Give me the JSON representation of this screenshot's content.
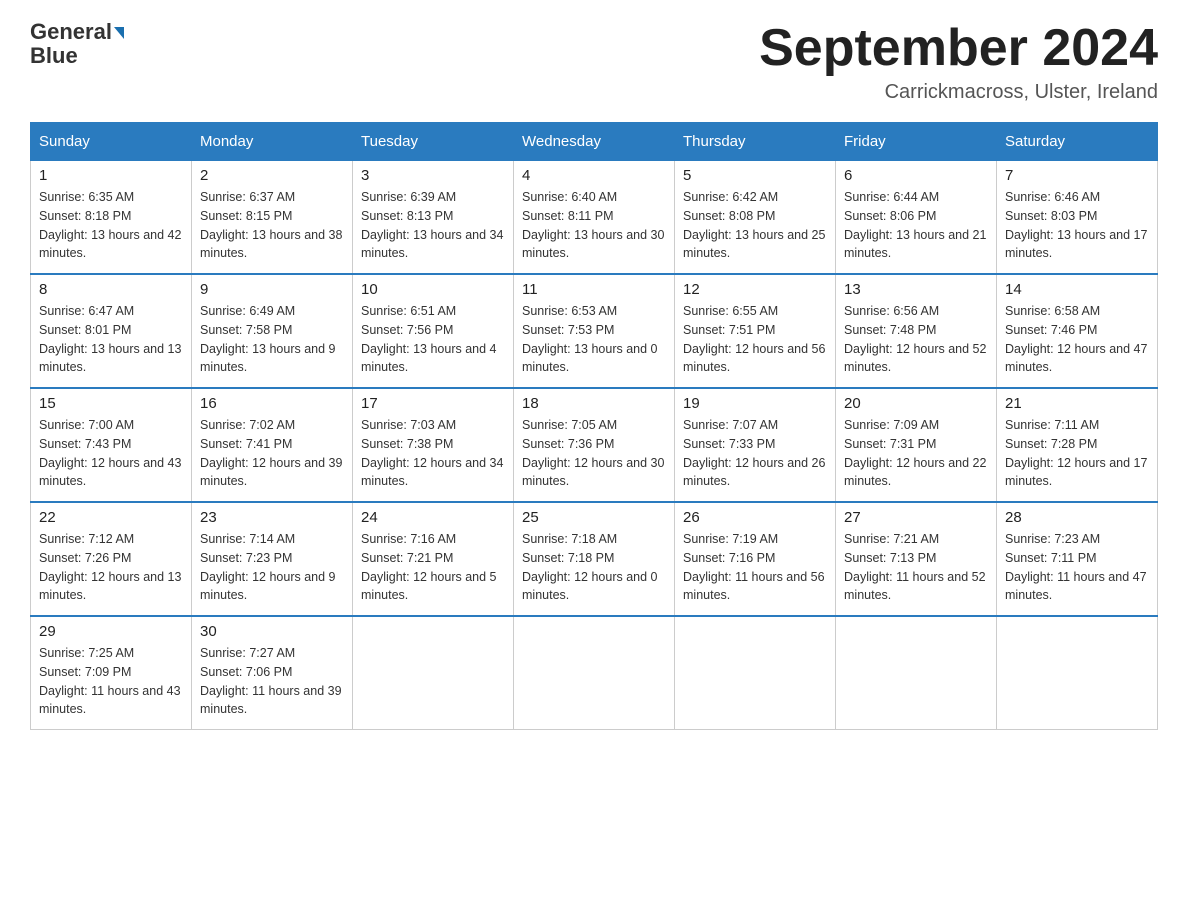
{
  "header": {
    "logo_line1": "General",
    "logo_line2": "Blue",
    "month_title": "September 2024",
    "location": "Carrickmacross, Ulster, Ireland"
  },
  "days_of_week": [
    "Sunday",
    "Monday",
    "Tuesday",
    "Wednesday",
    "Thursday",
    "Friday",
    "Saturday"
  ],
  "weeks": [
    [
      {
        "day": "1",
        "sunrise": "6:35 AM",
        "sunset": "8:18 PM",
        "daylight": "13 hours and 42 minutes."
      },
      {
        "day": "2",
        "sunrise": "6:37 AM",
        "sunset": "8:15 PM",
        "daylight": "13 hours and 38 minutes."
      },
      {
        "day": "3",
        "sunrise": "6:39 AM",
        "sunset": "8:13 PM",
        "daylight": "13 hours and 34 minutes."
      },
      {
        "day": "4",
        "sunrise": "6:40 AM",
        "sunset": "8:11 PM",
        "daylight": "13 hours and 30 minutes."
      },
      {
        "day": "5",
        "sunrise": "6:42 AM",
        "sunset": "8:08 PM",
        "daylight": "13 hours and 25 minutes."
      },
      {
        "day": "6",
        "sunrise": "6:44 AM",
        "sunset": "8:06 PM",
        "daylight": "13 hours and 21 minutes."
      },
      {
        "day": "7",
        "sunrise": "6:46 AM",
        "sunset": "8:03 PM",
        "daylight": "13 hours and 17 minutes."
      }
    ],
    [
      {
        "day": "8",
        "sunrise": "6:47 AM",
        "sunset": "8:01 PM",
        "daylight": "13 hours and 13 minutes."
      },
      {
        "day": "9",
        "sunrise": "6:49 AM",
        "sunset": "7:58 PM",
        "daylight": "13 hours and 9 minutes."
      },
      {
        "day": "10",
        "sunrise": "6:51 AM",
        "sunset": "7:56 PM",
        "daylight": "13 hours and 4 minutes."
      },
      {
        "day": "11",
        "sunrise": "6:53 AM",
        "sunset": "7:53 PM",
        "daylight": "13 hours and 0 minutes."
      },
      {
        "day": "12",
        "sunrise": "6:55 AM",
        "sunset": "7:51 PM",
        "daylight": "12 hours and 56 minutes."
      },
      {
        "day": "13",
        "sunrise": "6:56 AM",
        "sunset": "7:48 PM",
        "daylight": "12 hours and 52 minutes."
      },
      {
        "day": "14",
        "sunrise": "6:58 AM",
        "sunset": "7:46 PM",
        "daylight": "12 hours and 47 minutes."
      }
    ],
    [
      {
        "day": "15",
        "sunrise": "7:00 AM",
        "sunset": "7:43 PM",
        "daylight": "12 hours and 43 minutes."
      },
      {
        "day": "16",
        "sunrise": "7:02 AM",
        "sunset": "7:41 PM",
        "daylight": "12 hours and 39 minutes."
      },
      {
        "day": "17",
        "sunrise": "7:03 AM",
        "sunset": "7:38 PM",
        "daylight": "12 hours and 34 minutes."
      },
      {
        "day": "18",
        "sunrise": "7:05 AM",
        "sunset": "7:36 PM",
        "daylight": "12 hours and 30 minutes."
      },
      {
        "day": "19",
        "sunrise": "7:07 AM",
        "sunset": "7:33 PM",
        "daylight": "12 hours and 26 minutes."
      },
      {
        "day": "20",
        "sunrise": "7:09 AM",
        "sunset": "7:31 PM",
        "daylight": "12 hours and 22 minutes."
      },
      {
        "day": "21",
        "sunrise": "7:11 AM",
        "sunset": "7:28 PM",
        "daylight": "12 hours and 17 minutes."
      }
    ],
    [
      {
        "day": "22",
        "sunrise": "7:12 AM",
        "sunset": "7:26 PM",
        "daylight": "12 hours and 13 minutes."
      },
      {
        "day": "23",
        "sunrise": "7:14 AM",
        "sunset": "7:23 PM",
        "daylight": "12 hours and 9 minutes."
      },
      {
        "day": "24",
        "sunrise": "7:16 AM",
        "sunset": "7:21 PM",
        "daylight": "12 hours and 5 minutes."
      },
      {
        "day": "25",
        "sunrise": "7:18 AM",
        "sunset": "7:18 PM",
        "daylight": "12 hours and 0 minutes."
      },
      {
        "day": "26",
        "sunrise": "7:19 AM",
        "sunset": "7:16 PM",
        "daylight": "11 hours and 56 minutes."
      },
      {
        "day": "27",
        "sunrise": "7:21 AM",
        "sunset": "7:13 PM",
        "daylight": "11 hours and 52 minutes."
      },
      {
        "day": "28",
        "sunrise": "7:23 AM",
        "sunset": "7:11 PM",
        "daylight": "11 hours and 47 minutes."
      }
    ],
    [
      {
        "day": "29",
        "sunrise": "7:25 AM",
        "sunset": "7:09 PM",
        "daylight": "11 hours and 43 minutes."
      },
      {
        "day": "30",
        "sunrise": "7:27 AM",
        "sunset": "7:06 PM",
        "daylight": "11 hours and 39 minutes."
      },
      null,
      null,
      null,
      null,
      null
    ]
  ]
}
